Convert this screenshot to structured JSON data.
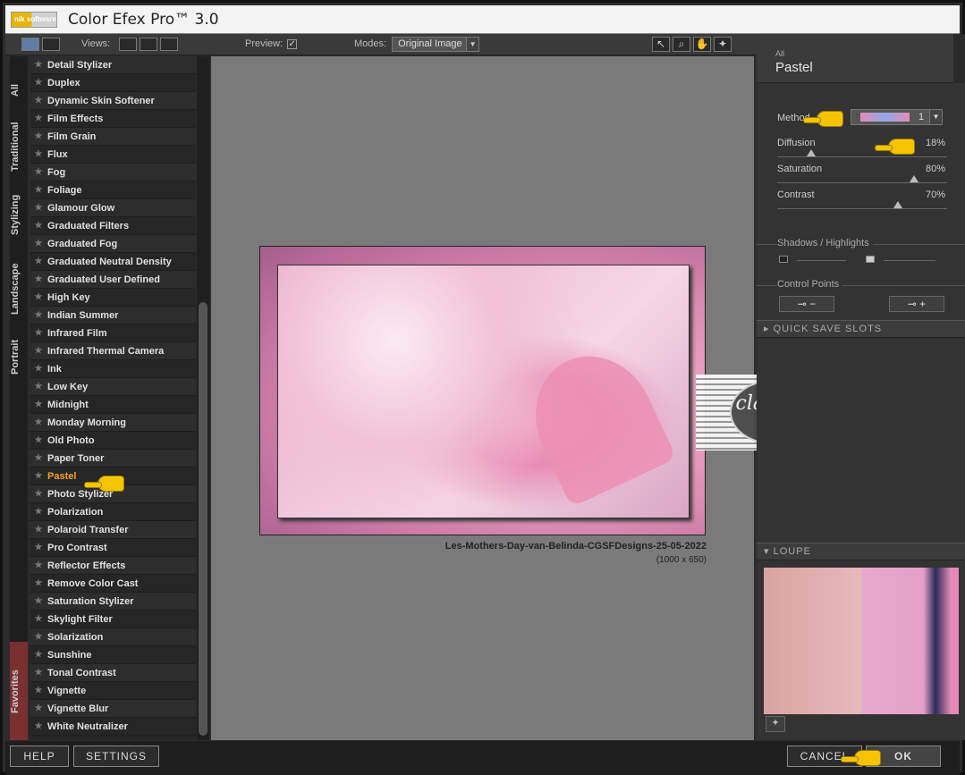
{
  "app": {
    "title": "Color Efex Pro™ 3.0",
    "logo_text": "nik software"
  },
  "toolbar": {
    "views_label": "Views:",
    "preview_label": "Preview:",
    "preview_checked": "✓",
    "modes_label": "Modes:",
    "modes_value": "Original Image"
  },
  "sidetabs": [
    "All",
    "Traditional",
    "Stylizing",
    "Landscape",
    "Portrait",
    "Favorites"
  ],
  "filters": [
    "Detail Stylizer",
    "Duplex",
    "Dynamic Skin Softener",
    "Film Effects",
    "Film Grain",
    "Flux",
    "Fog",
    "Foliage",
    "Glamour Glow",
    "Graduated Filters",
    "Graduated Fog",
    "Graduated Neutral Density",
    "Graduated User Defined",
    "High Key",
    "Indian Summer",
    "Infrared Film",
    "Infrared Thermal Camera",
    "Ink",
    "Low Key",
    "Midnight",
    "Monday Morning",
    "Old Photo",
    "Paper Toner",
    "Pastel",
    "Photo Stylizer",
    "Polarization",
    "Polaroid Transfer",
    "Pro Contrast",
    "Reflector Effects",
    "Remove Color Cast",
    "Saturation Stylizer",
    "Skylight Filter",
    "Solarization",
    "Sunshine",
    "Tonal Contrast",
    "Vignette",
    "Vignette Blur",
    "White Neutralizer"
  ],
  "active_filter": "Pastel",
  "preview": {
    "filename": "Les-Mothers-Day-van-Belinda-CGSFDesigns-25-05-2022",
    "dimensions": "(1000 x 650)",
    "watermark": "claudia"
  },
  "panel": {
    "category": "All",
    "filter_name": "Pastel",
    "method_label": "Method",
    "method_value": "1",
    "diffusion_label": "Diffusion",
    "diffusion_value": "18%",
    "diffusion_level": 0.18,
    "saturation_label": "Saturation",
    "saturation_value": "80%",
    "saturation_level": 0.8,
    "contrast_label": "Contrast",
    "contrast_value": "70%",
    "contrast_level": 0.7,
    "shadows_label": "Shadows / Highlights",
    "control_points_label": "Control Points",
    "quick_save_label": "QUICK SAVE SLOTS",
    "loupe_label": "LOUPE"
  },
  "bottom": {
    "help": "HELP",
    "settings": "SETTINGS",
    "cancel": "CANCEL",
    "ok": "OK"
  }
}
